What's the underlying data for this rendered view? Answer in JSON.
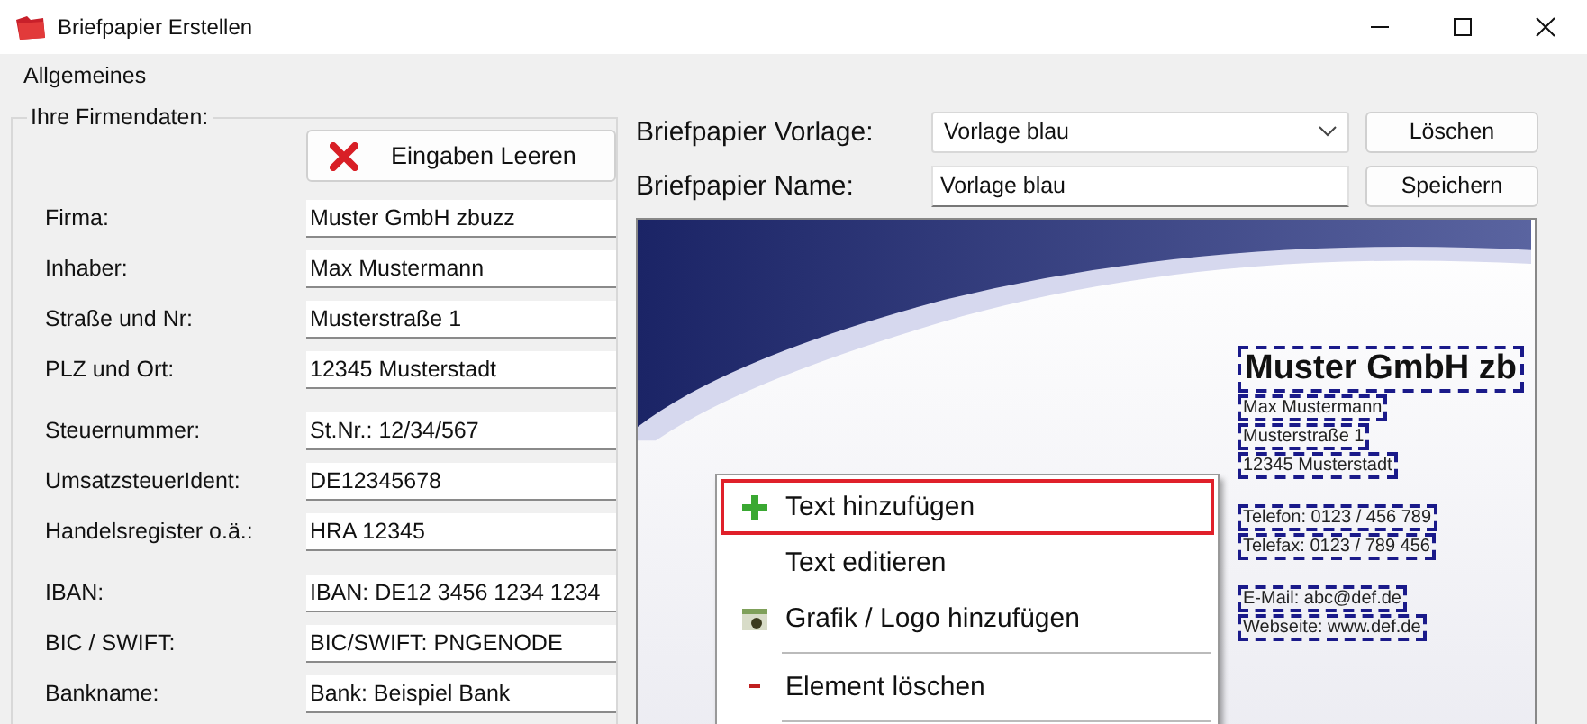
{
  "window": {
    "title": "Briefpapier Erstellen"
  },
  "menu": [
    "Allgemeines"
  ],
  "company": {
    "title": "Ihre Firmendaten:",
    "clear_button": "Eingaben Leeren",
    "groups": [
      [
        {
          "label": "Firma:",
          "value": "Muster GmbH zbuzz"
        },
        {
          "label": "Inhaber:",
          "value": "Max Mustermann"
        },
        {
          "label": "Straße und Nr:",
          "value": "Musterstraße 1"
        },
        {
          "label": "PLZ und Ort:",
          "value": "12345 Musterstadt"
        }
      ],
      [
        {
          "label": "Steuernummer:",
          "value": "St.Nr.: 12/34/567"
        },
        {
          "label": "UmsatzsteuerIdent:",
          "value": "DE12345678"
        },
        {
          "label": "Handelsregister o.ä.:",
          "value": "HRA 12345"
        }
      ],
      [
        {
          "label": "IBAN:",
          "value": "IBAN: DE12 3456 1234 1234"
        },
        {
          "label": "BIC  / SWIFT:",
          "value": "BIC/SWIFT: PNGENODE"
        },
        {
          "label": "Bankname:",
          "value": "Bank: Beispiel Bank"
        }
      ]
    ]
  },
  "template": {
    "label": "Briefpapier Vorlage:",
    "value": "Vorlage blau",
    "button": "Löschen"
  },
  "name": {
    "label": "Briefpapier Name:",
    "value": "Vorlage blau",
    "button": "Speichern"
  },
  "preview": {
    "blocks": [
      {
        "kind": "title",
        "lines": [
          "Muster GmbH zb"
        ]
      },
      {
        "kind": "line",
        "lines": [
          "Max Mustermann"
        ]
      },
      {
        "kind": "line",
        "lines": [
          "Musterstraße 1"
        ]
      },
      {
        "kind": "line",
        "lines": [
          "12345 Musterstadt"
        ]
      },
      {
        "kind": "gap"
      },
      {
        "kind": "line",
        "lines": [
          "Telefon: 0123 / 456 789"
        ]
      },
      {
        "kind": "line",
        "lines": [
          "Telefax: 0123 / 789 456"
        ]
      },
      {
        "kind": "gap"
      },
      {
        "kind": "line",
        "lines": [
          "E-Mail: abc@def.de"
        ]
      },
      {
        "kind": "line",
        "lines": [
          "Webseite: www.def.de"
        ]
      }
    ]
  },
  "context_menu": [
    {
      "kind": "add",
      "label": "Text hinzufügen",
      "selected": true
    },
    {
      "kind": "edit",
      "label": "Text editieren",
      "selected": false
    },
    {
      "kind": "image",
      "label": "Grafik / Logo hinzufügen",
      "selected": false
    },
    {
      "kind": "separator"
    },
    {
      "kind": "delete",
      "label": "Element löschen",
      "selected": false
    },
    {
      "kind": "separator"
    }
  ]
}
